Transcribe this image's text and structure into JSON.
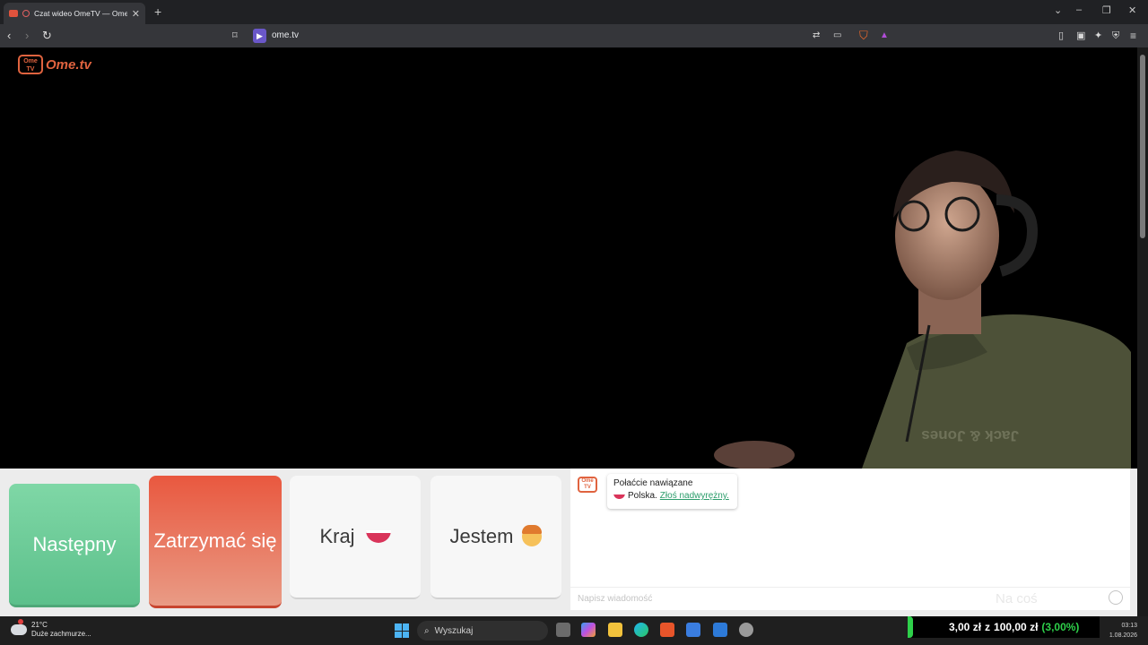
{
  "browser": {
    "tab_title": "Czat wideo OmeTV — Omeg",
    "url": "ome.tv"
  },
  "site": {
    "logo_badge": "Ome TV",
    "logo_text": "Ome.tv"
  },
  "controls": {
    "next_label": "Następny",
    "stop_label": "Zatrzymać się",
    "country_label": "Kraj",
    "gender_label": "Jestem"
  },
  "chat": {
    "badge": "Ome TV",
    "message_line1": "Połaćcie nawiązane",
    "message_country": "Polska.",
    "report_link": "Złoś nadwyrężny.",
    "input_placeholder": "Napisz wiadomość",
    "watermark": "Na coś"
  },
  "taskbar": {
    "temp": "21°C",
    "weather": "Duże zachmurze...",
    "search_label": "Wyszukaj",
    "ticker_amount": "3,00 zł",
    "ticker_of": "z",
    "ticker_total": "100,00 zł",
    "ticker_pct": "(3,00%)",
    "time": "03:13",
    "date": "1.08.2026"
  },
  "colors": {
    "next": "#6cca98",
    "stop": "#e9583f",
    "brand": "#e0633f",
    "ticker_green": "#2ed04a"
  }
}
